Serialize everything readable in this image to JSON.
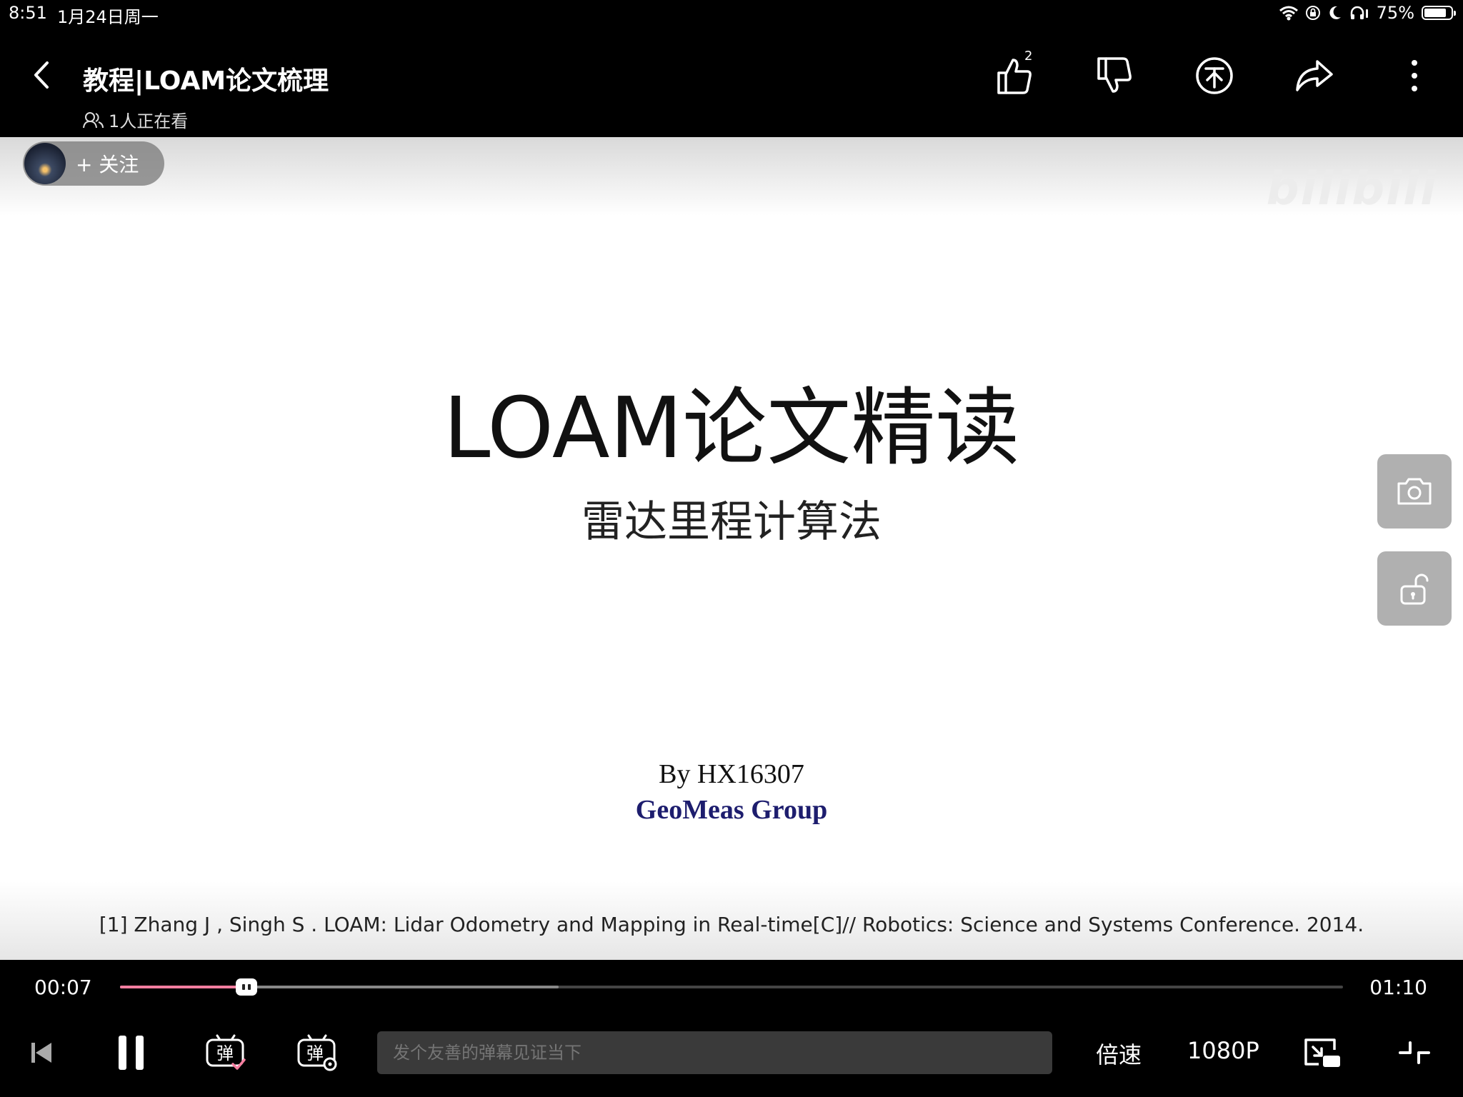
{
  "status_bar": {
    "time": "8:51",
    "date": "1月24日周一",
    "battery": "75%"
  },
  "header": {
    "title": "教程|LOAM论文梳理",
    "viewers": "1人正在看",
    "like_count": "2"
  },
  "video": {
    "follow_label": "+ 关注",
    "watermark": "bilibili",
    "slide": {
      "title": "LOAM论文精读",
      "subtitle": "雷达里程计算法",
      "author": "By HX16307",
      "group": "GeoMeas Group",
      "reference": "[1] Zhang J , Singh S . LOAM: Lidar Odometry and Mapping in Real-time[C]// Robotics: Science and Systems Conference. 2014."
    }
  },
  "player": {
    "current_time": "00:07",
    "total_time": "01:10",
    "progress_fraction": 0.1,
    "danmaku_placeholder": "发个友善的弹幕见证当下",
    "speed_label": "倍速",
    "quality_label": "1080P"
  },
  "icons": [
    "back-icon",
    "like-icon",
    "dislike-icon",
    "coin-icon",
    "share-icon",
    "more-icon",
    "camera-icon",
    "lock-icon",
    "skip-previous-icon",
    "pause-icon",
    "danmaku-on-icon",
    "danmaku-settings-icon",
    "picture-in-picture-icon",
    "exit-fullscreen-icon"
  ]
}
